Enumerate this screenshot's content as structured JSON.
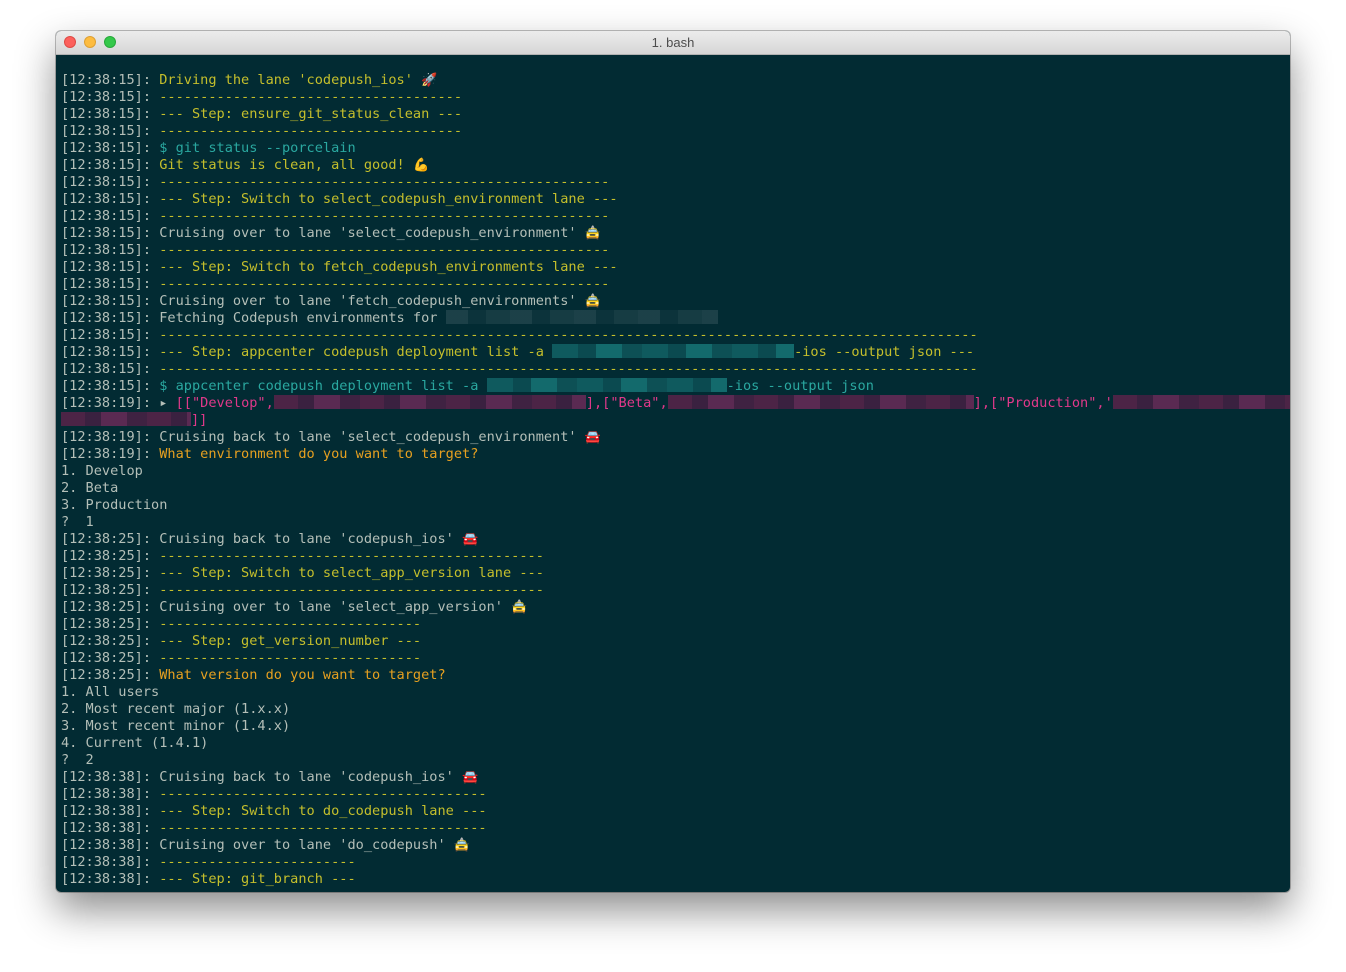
{
  "window": {
    "title": "1. bash"
  },
  "colors": {
    "background": "#022b33",
    "timestamp": "#b4bfb8",
    "yellow": "#c5bf2c",
    "cyan": "#2aa8a0",
    "orange": "#e6a020",
    "magenta": "#e0398a"
  },
  "lines": [
    {
      "ts": "[12:38:15]: ",
      "segs": [
        {
          "t": "Driving the lane 'codepush_ios' ",
          "c": "y"
        },
        {
          "t": "🚀",
          "c": "emoji"
        }
      ]
    },
    {
      "ts": "[12:38:15]: ",
      "segs": [
        {
          "t": "-------------------------------------",
          "c": "y"
        }
      ]
    },
    {
      "ts": "[12:38:15]: ",
      "segs": [
        {
          "t": "--- Step: ensure_git_status_clean ---",
          "c": "y"
        }
      ]
    },
    {
      "ts": "[12:38:15]: ",
      "segs": [
        {
          "t": "-------------------------------------",
          "c": "y"
        }
      ]
    },
    {
      "ts": "[12:38:15]: ",
      "segs": [
        {
          "t": "$ git status --porcelain",
          "c": "c"
        }
      ]
    },
    {
      "ts": "[12:38:15]: ",
      "segs": [
        {
          "t": "Git status is clean, all good! ",
          "c": "y"
        },
        {
          "t": "💪",
          "c": "emoji"
        }
      ]
    },
    {
      "ts": "[12:38:15]: ",
      "segs": [
        {
          "t": "-------------------------------------------------------",
          "c": "y"
        }
      ]
    },
    {
      "ts": "[12:38:15]: ",
      "segs": [
        {
          "t": "--- Step: Switch to select_codepush_environment lane ---",
          "c": "y"
        }
      ]
    },
    {
      "ts": "[12:38:15]: ",
      "segs": [
        {
          "t": "-------------------------------------------------------",
          "c": "y"
        }
      ]
    },
    {
      "ts": "[12:38:15]: ",
      "segs": [
        {
          "t": "Cruising over to lane 'select_codepush_environment' ",
          "c": "p"
        },
        {
          "t": "🚖",
          "c": "emoji"
        }
      ]
    },
    {
      "ts": "[12:38:15]: ",
      "segs": [
        {
          "t": "-------------------------------------------------------",
          "c": "y"
        }
      ]
    },
    {
      "ts": "[12:38:15]: ",
      "segs": [
        {
          "t": "--- Step: Switch to fetch_codepush_environments lane ---",
          "c": "y"
        }
      ]
    },
    {
      "ts": "[12:38:15]: ",
      "segs": [
        {
          "t": "-------------------------------------------------------",
          "c": "y"
        }
      ]
    },
    {
      "ts": "[12:38:15]: ",
      "segs": [
        {
          "t": "Cruising over to lane 'fetch_codepush_environments' ",
          "c": "p"
        },
        {
          "t": "🚖",
          "c": "emoji"
        }
      ]
    },
    {
      "ts": "[12:38:15]: ",
      "segs": [
        {
          "t": "Fetching Codepush environments for ",
          "c": "p"
        },
        {
          "blur": 272,
          "k": "grey"
        }
      ]
    },
    {
      "ts": "[12:38:15]: ",
      "segs": [
        {
          "t": "----------------------------------------------------------------------------------------------------",
          "c": "y"
        }
      ]
    },
    {
      "ts": "[12:38:15]: ",
      "segs": [
        {
          "t": "--- Step: appcenter codepush deployment list -a ",
          "c": "y"
        },
        {
          "blur": 242,
          "k": "teal"
        },
        {
          "t": "-ios --output json ---",
          "c": "y"
        }
      ]
    },
    {
      "ts": "[12:38:15]: ",
      "segs": [
        {
          "t": "----------------------------------------------------------------------------------------------------",
          "c": "y"
        }
      ]
    },
    {
      "ts": "[12:38:15]: ",
      "segs": [
        {
          "t": "$ appcenter codepush deployment list -a ",
          "c": "c"
        },
        {
          "blur": 240,
          "k": "teal"
        },
        {
          "t": "-ios --output json",
          "c": "c"
        }
      ]
    },
    {
      "ts": "[12:38:19]: ",
      "segs": [
        {
          "t": "▸ ",
          "c": "p"
        },
        {
          "t": "[[\"Develop\",",
          "c": "m"
        },
        {
          "blur": 312,
          "k": "mag"
        },
        {
          "t": "],[\"Beta\",",
          "c": "m"
        },
        {
          "blur": 306,
          "k": "mag"
        },
        {
          "t": "],[\"Production\",'",
          "c": "m"
        },
        {
          "blur": 180,
          "k": "mag"
        }
      ]
    },
    {
      "ts": "",
      "segs": [
        {
          "blur": 130,
          "k": "mag"
        },
        {
          "t": "]]",
          "c": "m"
        }
      ]
    },
    {
      "ts": "[12:38:19]: ",
      "segs": [
        {
          "t": "Cruising back to lane 'select_codepush_environment' ",
          "c": "p"
        },
        {
          "t": "🚘",
          "c": "emoji"
        }
      ]
    },
    {
      "ts": "[12:38:19]: ",
      "segs": [
        {
          "t": "What environment do you want to target?",
          "c": "o"
        }
      ]
    },
    {
      "ts": "",
      "segs": [
        {
          "t": "1. Develop",
          "c": "p"
        }
      ]
    },
    {
      "ts": "",
      "segs": [
        {
          "t": "2. Beta",
          "c": "p"
        }
      ]
    },
    {
      "ts": "",
      "segs": [
        {
          "t": "3. Production",
          "c": "p"
        }
      ]
    },
    {
      "ts": "",
      "segs": [
        {
          "t": "?  1",
          "c": "p"
        }
      ]
    },
    {
      "ts": "[12:38:25]: ",
      "segs": [
        {
          "t": "Cruising back to lane 'codepush_ios' ",
          "c": "p"
        },
        {
          "t": "🚘",
          "c": "emoji"
        }
      ]
    },
    {
      "ts": "[12:38:25]: ",
      "segs": [
        {
          "t": "-----------------------------------------------",
          "c": "y"
        }
      ]
    },
    {
      "ts": "[12:38:25]: ",
      "segs": [
        {
          "t": "--- Step: Switch to select_app_version lane ---",
          "c": "y"
        }
      ]
    },
    {
      "ts": "[12:38:25]: ",
      "segs": [
        {
          "t": "-----------------------------------------------",
          "c": "y"
        }
      ]
    },
    {
      "ts": "[12:38:25]: ",
      "segs": [
        {
          "t": "Cruising over to lane 'select_app_version' ",
          "c": "p"
        },
        {
          "t": "🚖",
          "c": "emoji"
        }
      ]
    },
    {
      "ts": "[12:38:25]: ",
      "segs": [
        {
          "t": "--------------------------------",
          "c": "y"
        }
      ]
    },
    {
      "ts": "[12:38:25]: ",
      "segs": [
        {
          "t": "--- Step: get_version_number ---",
          "c": "y"
        }
      ]
    },
    {
      "ts": "[12:38:25]: ",
      "segs": [
        {
          "t": "--------------------------------",
          "c": "y"
        }
      ]
    },
    {
      "ts": "[12:38:25]: ",
      "segs": [
        {
          "t": "What version do you want to target?",
          "c": "o"
        }
      ]
    },
    {
      "ts": "",
      "segs": [
        {
          "t": "1. All users",
          "c": "p"
        }
      ]
    },
    {
      "ts": "",
      "segs": [
        {
          "t": "2. Most recent major (1.x.x)",
          "c": "p"
        }
      ]
    },
    {
      "ts": "",
      "segs": [
        {
          "t": "3. Most recent minor (1.4.x)",
          "c": "p"
        }
      ]
    },
    {
      "ts": "",
      "segs": [
        {
          "t": "4. Current (1.4.1)",
          "c": "p"
        }
      ]
    },
    {
      "ts": "",
      "segs": [
        {
          "t": "?  2",
          "c": "p"
        }
      ]
    },
    {
      "ts": "[12:38:38]: ",
      "segs": [
        {
          "t": "Cruising back to lane 'codepush_ios' ",
          "c": "p"
        },
        {
          "t": "🚘",
          "c": "emoji"
        }
      ]
    },
    {
      "ts": "[12:38:38]: ",
      "segs": [
        {
          "t": "----------------------------------------",
          "c": "y"
        }
      ]
    },
    {
      "ts": "[12:38:38]: ",
      "segs": [
        {
          "t": "--- Step: Switch to do_codepush lane ---",
          "c": "y"
        }
      ]
    },
    {
      "ts": "[12:38:38]: ",
      "segs": [
        {
          "t": "----------------------------------------",
          "c": "y"
        }
      ]
    },
    {
      "ts": "[12:38:38]: ",
      "segs": [
        {
          "t": "Cruising over to lane 'do_codepush' ",
          "c": "p"
        },
        {
          "t": "🚖",
          "c": "emoji"
        }
      ]
    },
    {
      "ts": "[12:38:38]: ",
      "segs": [
        {
          "t": "------------------------",
          "c": "y"
        }
      ]
    },
    {
      "ts": "[12:38:38]: ",
      "segs": [
        {
          "t": "--- Step: git_branch ---",
          "c": "y"
        }
      ]
    }
  ]
}
